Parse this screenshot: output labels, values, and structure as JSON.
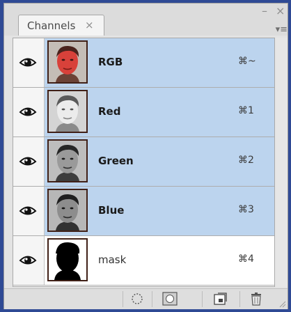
{
  "panel": {
    "tab_label": "Channels",
    "close_glyph": "×",
    "minimize_glyph": "–",
    "window_close_glyph": "×",
    "menu_glyph": "▾≡"
  },
  "channels": [
    {
      "name": "RGB",
      "shortcut": "⌘~",
      "selected": true,
      "thumb": "rgb-face"
    },
    {
      "name": "Red",
      "shortcut": "⌘1",
      "selected": true,
      "thumb": "red-face"
    },
    {
      "name": "Green",
      "shortcut": "⌘2",
      "selected": true,
      "thumb": "green-face"
    },
    {
      "name": "Blue",
      "shortcut": "⌘3",
      "selected": true,
      "thumb": "blue-face"
    },
    {
      "name": "mask",
      "shortcut": "⌘4",
      "selected": false,
      "thumb": "mask-silhouette"
    }
  ],
  "footer": {
    "buttons": [
      "load-selection-icon",
      "save-selection-icon",
      "new-channel-icon",
      "trash-icon"
    ]
  },
  "colors": {
    "selected_row": "#bcd4ee",
    "background": "#2f4a95"
  }
}
